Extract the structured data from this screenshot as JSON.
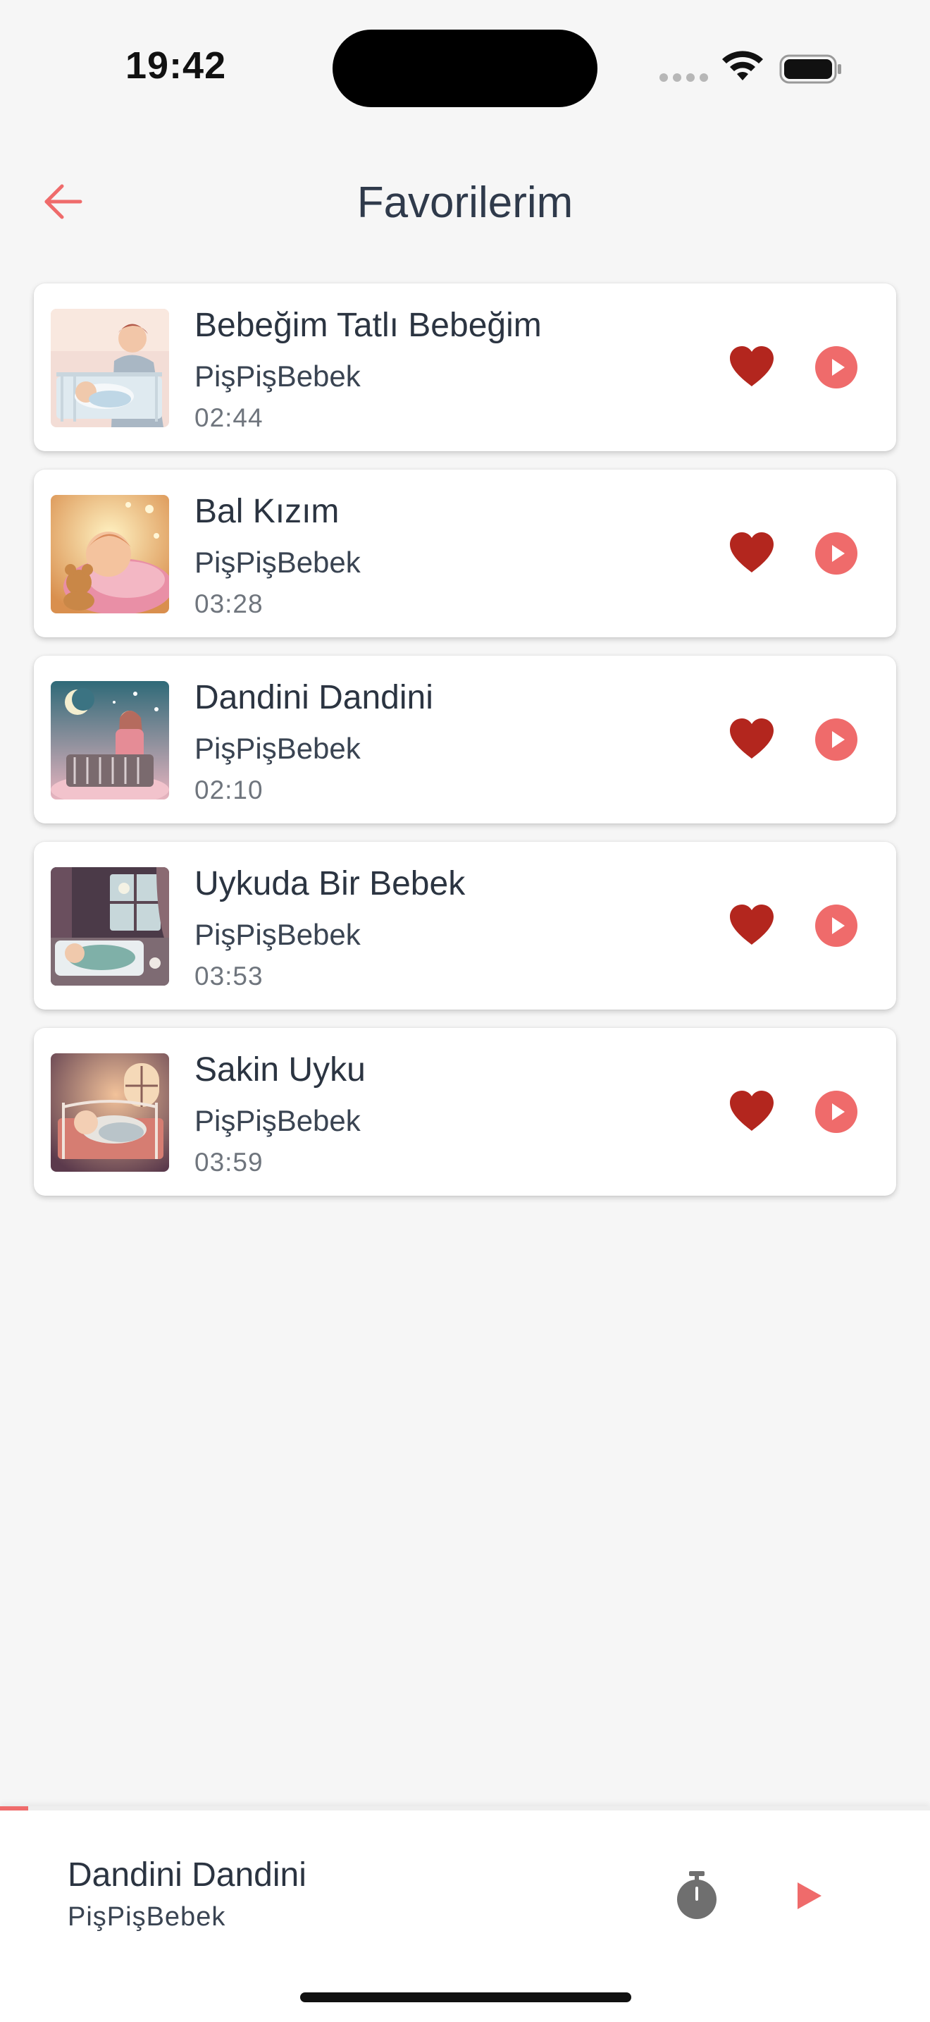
{
  "status_bar": {
    "time": "19:42",
    "icons": [
      "cellular-dots-icon",
      "wifi-icon",
      "battery-icon"
    ]
  },
  "header": {
    "title": "Favorilerim",
    "back_icon": "arrow-left-icon"
  },
  "colors": {
    "accent": "#EF6B6B",
    "heart": "#B3261E",
    "background": "#F6F6F6",
    "card": "#FFFFFF",
    "text_primary": "#2B3441",
    "text_secondary": "#6F757D"
  },
  "songs": [
    {
      "title": "Bebeğim Tatlı Bebeğim",
      "artist": "PişPişBebek",
      "duration": "02:44",
      "favorite": true,
      "thumb": "mother-crib-illustration"
    },
    {
      "title": "Bal Kızım",
      "artist": "PişPişBebek",
      "duration": "03:28",
      "favorite": true,
      "thumb": "sleeping-baby-bear-illustration"
    },
    {
      "title": "Dandini Dandini",
      "artist": "PişPişBebek",
      "duration": "02:10",
      "favorite": true,
      "thumb": "night-lullaby-illustration"
    },
    {
      "title": "Uykuda Bir Bebek",
      "artist": "PişPişBebek",
      "duration": "03:53",
      "favorite": true,
      "thumb": "baby-window-illustration"
    },
    {
      "title": "Sakin Uyku",
      "artist": "PişPişBebek",
      "duration": "03:59",
      "favorite": true,
      "thumb": "baby-crib-room-illustration"
    }
  ],
  "now_playing": {
    "title": "Dandini Dandini",
    "artist": "PişPişBebek",
    "progress": 0.03,
    "timer_icon": "stopwatch-icon",
    "play_icon": "play-icon"
  }
}
